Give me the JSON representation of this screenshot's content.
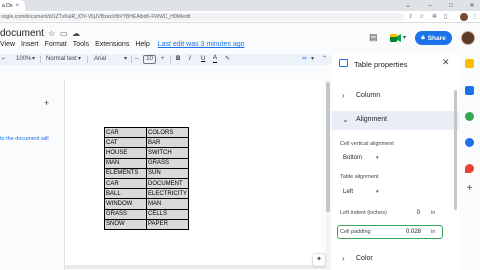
{
  "browser": {
    "tab_title": "a Do",
    "tab_close": "×",
    "url": "oogle.com/document/d/1ZTxKaiR_lOV-V6jJVBzezXfbVYBHEAlbdK-FWWC_H0M/edit",
    "minimize": "–",
    "maximize": "□",
    "close": "✕",
    "chevron": "⌄"
  },
  "docs": {
    "title": "document",
    "menu": [
      "View",
      "Insert",
      "Format",
      "Tools",
      "Extensions",
      "Help"
    ],
    "last_edit": "Last edit was 3 minutes ago",
    "share_label": "Share"
  },
  "toolbar": {
    "zoom": "100%",
    "style": "Normal text",
    "font": "Arial",
    "minus": "–",
    "size": "10",
    "plus": "+",
    "bold": "B",
    "italic": "I",
    "underline": "U",
    "text_color": "A"
  },
  "outline": {
    "add": "+",
    "hint": "to the document will"
  },
  "table": {
    "rows": [
      [
        "CAR",
        "COLORS"
      ],
      [
        "CAT",
        "BAR"
      ],
      [
        "HOUSE",
        "SWITCH"
      ],
      [
        "MAN",
        "GRASS"
      ],
      [
        "ELEMENTS",
        "SUN"
      ],
      [
        "CAR",
        "DOCUMENT"
      ],
      [
        "BALL",
        "ELECTRICITY"
      ],
      [
        "WINDOW",
        "MAN"
      ],
      [
        "GRASS",
        "CELLS"
      ],
      [
        "SNOW",
        "PAPER"
      ]
    ]
  },
  "sidebar": {
    "title": "Table properties",
    "close": "✕",
    "sections": {
      "column": "Column",
      "alignment": "Alignment",
      "color": "Color"
    },
    "cell_vertical_alignment_label": "Cell vertical alignment",
    "cell_vertical_alignment_value": "Bottom",
    "table_alignment_label": "Table alignment",
    "table_alignment_value": "Left",
    "left_indent_label": "Left indent (inches)",
    "left_indent_value": "0",
    "cell_padding_label": "Cell padding",
    "cell_padding_value": "0.028",
    "unit": "in"
  },
  "colors": {
    "accent": "#1a73e8",
    "table_fill": "#d9d9d9",
    "padding_border": "#34a853"
  }
}
